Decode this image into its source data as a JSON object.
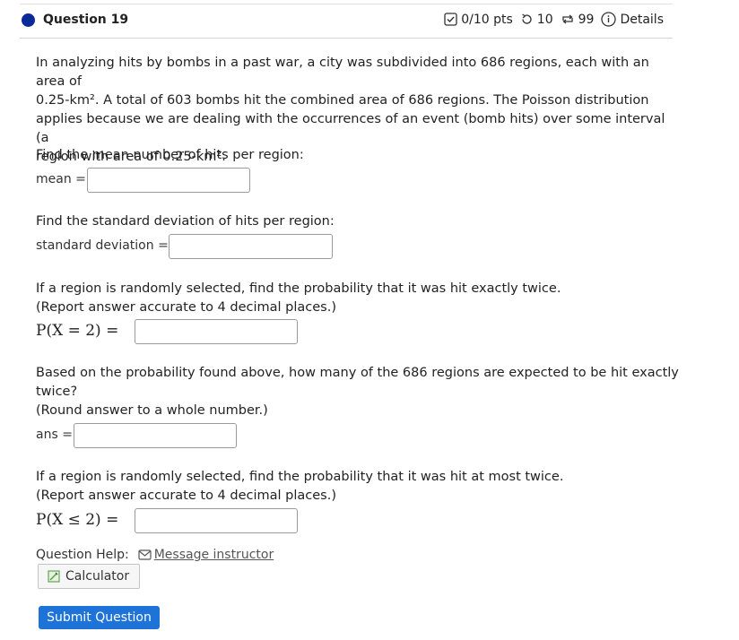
{
  "question": {
    "title": "Question 19",
    "points": "0/10 pts",
    "retries": "10",
    "attempts": "99",
    "details_label": "Details"
  },
  "intro": {
    "line1": "In analyzing hits by bombs in a past war, a city was subdivided into 686 regions, each with an area of",
    "line2": "0.25-km². A total of 603 bombs hit the combined area of 686 regions. The Poisson distribution",
    "line3": "applies because we are dealing with the occurrences of an event (bomb hits) over some interval (a",
    "line4": "region with area of 0.25-km²."
  },
  "parts": {
    "mean": {
      "prompt": "Find the mean number of hits per region:",
      "label": "mean =",
      "value": ""
    },
    "sd": {
      "prompt": "Find the standard deviation of hits per region:",
      "label": "standard deviation =",
      "value": ""
    },
    "p2": {
      "prompt": "If a region is randomly selected, find the probability that it was hit exactly twice.",
      "note": "(Report answer accurate to 4 decimal places.)",
      "label": "P(X = 2) =",
      "value": ""
    },
    "expected": {
      "prompt_line1": "Based on the probability found above, how many of the 686 regions are expected to be hit exactly",
      "prompt_line2": "twice?",
      "note": "(Round answer to a whole number.)",
      "label": "ans =",
      "value": ""
    },
    "ple2": {
      "prompt": "If a region is randomly selected, find the probability that it was hit at most twice.",
      "note": "(Report answer accurate to 4 decimal places.)",
      "label": "P(X ≤ 2) =",
      "value": ""
    }
  },
  "help": {
    "label": "Question Help:",
    "message_link": "Message instructor",
    "calculator": "Calculator"
  },
  "submit_label": "Submit Question",
  "colors": {
    "accent": "#1e73d8",
    "dot": "#0a2a9a"
  }
}
